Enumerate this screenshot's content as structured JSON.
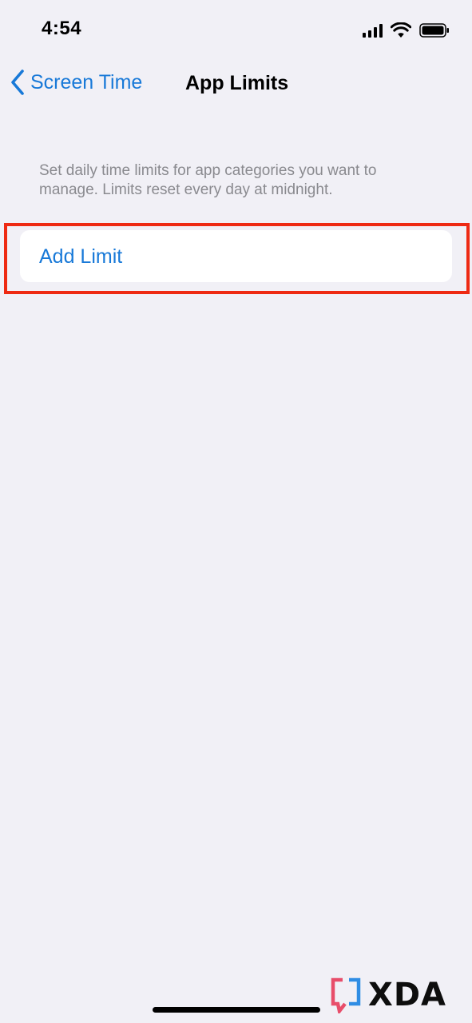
{
  "status_bar": {
    "time": "4:54",
    "icons": [
      "signal-icon",
      "wifi-icon",
      "battery-icon"
    ]
  },
  "nav": {
    "back_label": "Screen Time",
    "back_icon": "chevron-left-icon",
    "title": "App Limits"
  },
  "description": "Set daily time limits for app categories you want to manage. Limits reset every day at midnight.",
  "add_limit": {
    "label": "Add Limit"
  },
  "watermark": {
    "text": "XDA"
  },
  "colors": {
    "accent": "#1879d8",
    "background": "#f1f0f6",
    "highlight": "#ee2a13",
    "secondary_text": "#8a8a8f"
  }
}
